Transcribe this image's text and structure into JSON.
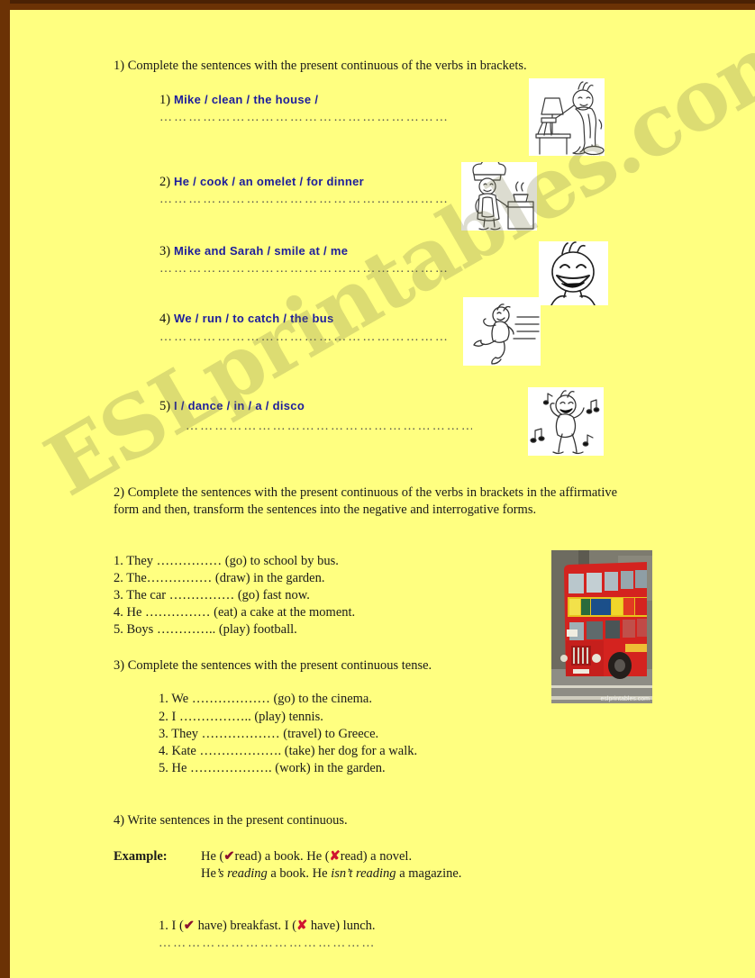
{
  "page": {
    "background_color": "#ffff80",
    "frame_color": "#6b3205",
    "watermark_text": "ESLprintables.com",
    "heading_color": "#1d1d9c"
  },
  "exercise1": {
    "instruction": "1) Complete the sentences with the present continuous of the verbs in brackets.",
    "items": [
      {
        "num": "1)",
        "prompt": "Mike / clean / the house /",
        "answer_line": "……………………………………………………",
        "image": "cleaning-house-clipart"
      },
      {
        "num": "2)",
        "prompt": "He / cook / an omelet / for dinner",
        "answer_line": "……………………………………………………",
        "image": "cooking-chef-clipart"
      },
      {
        "num": "3)",
        "prompt": "Mike and Sarah / smile at / me",
        "answer_line": "……………………………………………………",
        "image": "smiling-face-clipart"
      },
      {
        "num": "4)",
        "prompt": "We / run / to catch / the bus",
        "answer_line": "……………………………………………………",
        "image": "running-person-clipart"
      },
      {
        "num": "5)",
        "prompt": "I / dance / in / a / disco",
        "answer_line": "……………………………………………………",
        "image": "dancing-person-clipart"
      }
    ]
  },
  "exercise2": {
    "instruction": "2) Complete the sentences with the present continuous of the verbs in brackets in the affirmative form and then, transform the sentences into the negative and interrogative forms.",
    "items": [
      "1. They …………… (go) to school by bus.",
      "2. The…………… (draw) in the garden.",
      "3. The car …………… (go) fast now.",
      "4. He ……………  (eat) a cake at the moment.",
      "5. Boys ………….. (play) football."
    ],
    "image": "london-double-decker-bus-photo",
    "image_credit": "eslprintables.com"
  },
  "exercise3": {
    "instruction": "3) Complete the sentences with the present continuous tense.",
    "items": [
      "1.  We ………………  (go) to the cinema.",
      "2.  I …………….. (play) tennis.",
      "3.  They ………………   (travel) to Greece.",
      "4.  Kate ………………. (take) her dog for a walk.",
      "5.  He ………………. (work) in the garden."
    ]
  },
  "exercise4": {
    "instruction": "4) Write sentences in the present continuous.",
    "example_label": "Example:",
    "example_line1_a": "He (",
    "example_tick": "✔",
    "example_line1_b": "read) a book. He (",
    "example_cross": "✘",
    "example_line1_c": "read) a novel.",
    "example_line2_a": "He",
    "example_line2_italic1": "’s reading",
    "example_line2_b": "a book. He",
    "example_line2_italic2": "isn’t reading",
    "example_line2_c": "a magazine.",
    "item1_a": "1. I (",
    "item1_tick": "✔",
    "item1_b": "  have) breakfast. I (",
    "item1_cross": "✘",
    "item1_c": "  have) lunch.",
    "item1_answer_line": "………………………………………"
  }
}
